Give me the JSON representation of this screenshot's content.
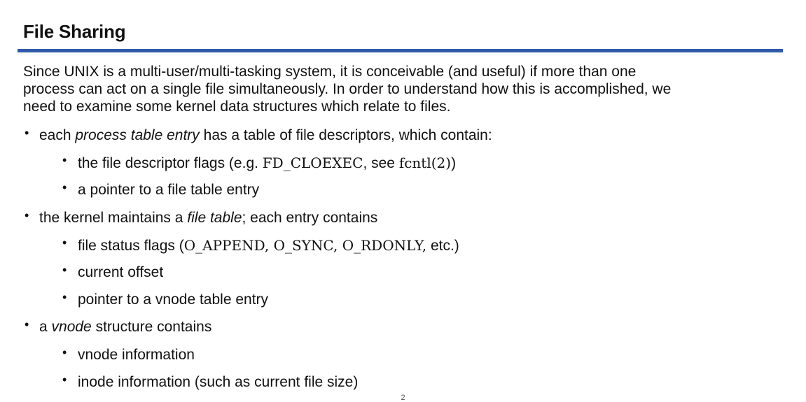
{
  "slide": {
    "top_clipped_text": "",
    "title": "File Sharing",
    "accent_color": "#2f5aa8",
    "intro_line_1": "Since UNIX is a multi-user/multi-tasking system, it is conceivable (and useful) if more than one",
    "intro_line_2": "process can act on a single file simultaneously. In order to understand how this is accomplished, we",
    "intro_line_3": "need to examine some kernel data structures which relate to files.",
    "page_number": "2"
  },
  "bullets": [
    {
      "level": 1,
      "pre": "each ",
      "em": "process table entry",
      "post": " has a table of file descriptors, which contain:"
    },
    {
      "level": 2,
      "pre": "the file descriptor flags (e.g. ",
      "code": "FD_CLOEXEC",
      "mid": ", see ",
      "code2": "fcntl(2)",
      "post": ")"
    },
    {
      "level": 2,
      "text": "a pointer to a file table entry"
    },
    {
      "level": 1,
      "pre": "the kernel maintains a ",
      "em": "file table",
      "post": "; each entry contains"
    },
    {
      "level": 2,
      "pre": "file status flags (",
      "code": "O_APPEND, O_SYNC, O_RDONLY,",
      "post": " etc.)"
    },
    {
      "level": 2,
      "text": "current offset"
    },
    {
      "level": 2,
      "text": "pointer to a vnode table entry"
    },
    {
      "level": 1,
      "pre": "a ",
      "em": "vnode",
      "post": " structure contains"
    },
    {
      "level": 2,
      "text": "vnode information"
    },
    {
      "level": 2,
      "text": "inode information (such as current file size)"
    }
  ]
}
